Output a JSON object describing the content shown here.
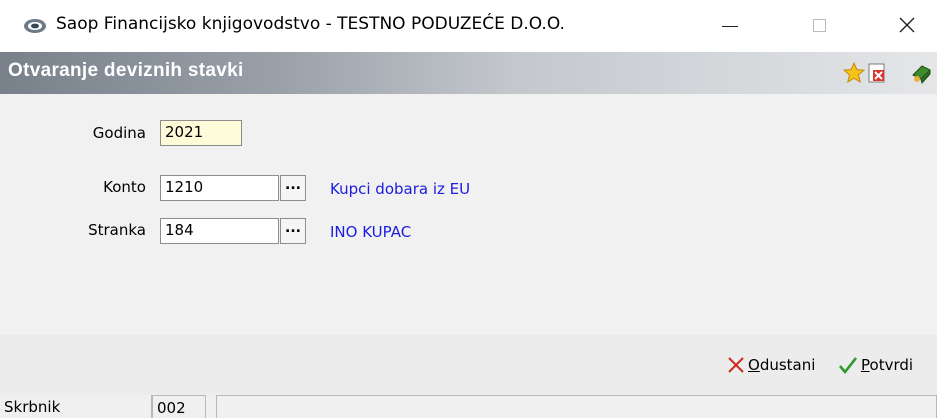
{
  "window": {
    "title": "Saop Financijsko knjigovodstvo - TESTNO PODUZEĆE D.O.O."
  },
  "panel": {
    "title": "Otvaranje deviznih stavki",
    "icons": [
      "star-icon",
      "document-delete-icon",
      "exit-icon"
    ]
  },
  "form": {
    "godina": {
      "label": "Godina",
      "value": "2021"
    },
    "konto": {
      "label": "Konto",
      "value": "1210",
      "button": "...",
      "description": "Kupci dobara iz EU"
    },
    "stranka": {
      "label": "Stranka",
      "value": "184",
      "button": "...",
      "description": "INO KUPAC"
    }
  },
  "actions": {
    "cancel": {
      "underlined": "O",
      "rest": "dustani"
    },
    "confirm": {
      "underlined": "P",
      "rest": "otvrdi"
    }
  },
  "statusbar": {
    "user": "Skrbnik",
    "code": "002",
    "message": ""
  },
  "colors": {
    "link_text": "#1c1ce0",
    "year_field_bg": "#fefbd9",
    "cancel_icon": "#cc2a1f",
    "confirm_icon": "#2a9c2a"
  }
}
